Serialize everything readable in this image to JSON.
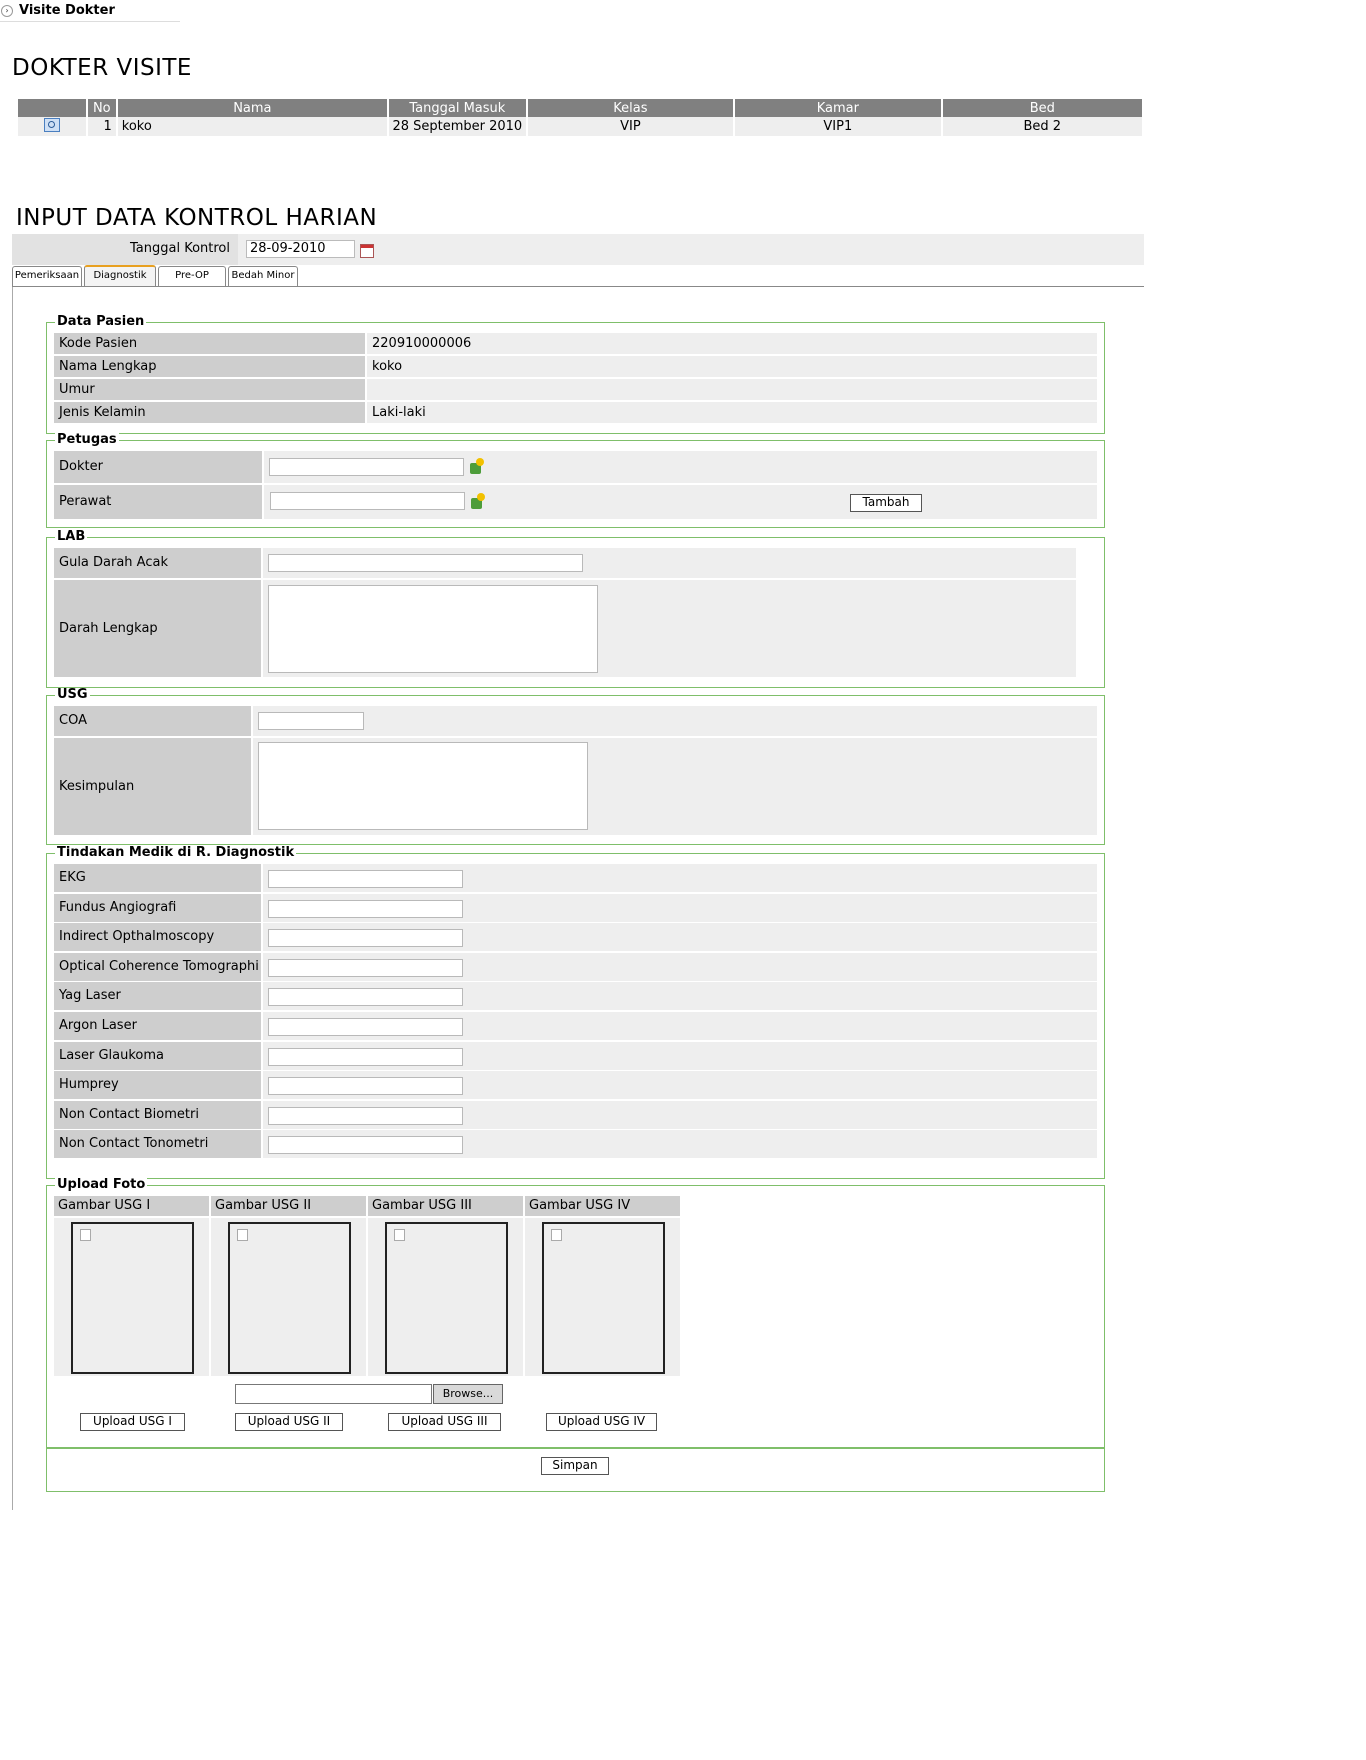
{
  "window": {
    "title": "Visite Dokter"
  },
  "page": {
    "heading": "DOKTER VISITE"
  },
  "visit_table": {
    "headers": [
      "",
      "No",
      "Nama",
      "Tanggal Masuk",
      "Kelas",
      "Kamar",
      "Bed"
    ],
    "rows": [
      {
        "no": "1",
        "nama": "koko",
        "tanggal_masuk": "28 September 2010",
        "kelas": "VIP",
        "kamar": "VIP1",
        "bed": "Bed 2"
      }
    ]
  },
  "input_section": {
    "heading": "INPUT DATA KONTROL HARIAN",
    "tanggal_label": "Tanggal Kontrol",
    "tanggal_value": "28-09-2010",
    "tabs": [
      "Pemeriksaan",
      "Diagnostik",
      "Pre-OP",
      "Bedah Minor"
    ],
    "active_tab": "Diagnostik"
  },
  "data_pasien": {
    "legend": "Data Pasien",
    "rows": [
      {
        "label": "Kode Pasien",
        "value": "220910000006"
      },
      {
        "label": "Nama Lengkap",
        "value": "koko"
      },
      {
        "label": "Umur",
        "value": ""
      },
      {
        "label": "Jenis Kelamin",
        "value": "Laki-laki"
      }
    ]
  },
  "petugas": {
    "legend": "Petugas",
    "dokter_label": "Dokter",
    "perawat_label": "Perawat",
    "tambah_label": "Tambah"
  },
  "lab": {
    "legend": "LAB",
    "gula_label": "Gula Darah Acak",
    "darah_label": "Darah Lengkap"
  },
  "usg": {
    "legend": "USG",
    "coa_label": "COA",
    "kesimpulan_label": "Kesimpulan"
  },
  "tindakan": {
    "legend": "Tindakan Medik di R. Diagnostik",
    "items": [
      "EKG",
      "Fundus Angiografi",
      "Indirect Opthalmoscopy",
      "Optical Coherence Tomographi",
      "Yag Laser",
      "Argon Laser",
      "Laser Glaukoma",
      "Humprey",
      "Non Contact Biometri",
      "Non Contact Tonometri"
    ]
  },
  "upload": {
    "legend": "Upload Foto",
    "headers": [
      "Gambar USG I",
      "Gambar USG II",
      "Gambar USG III",
      "Gambar USG IV"
    ],
    "browse_label": "Browse...",
    "buttons": [
      "Upload USG I",
      "Upload USG II",
      "Upload USG III",
      "Upload USG IV"
    ]
  },
  "simpan_label": "Simpan"
}
